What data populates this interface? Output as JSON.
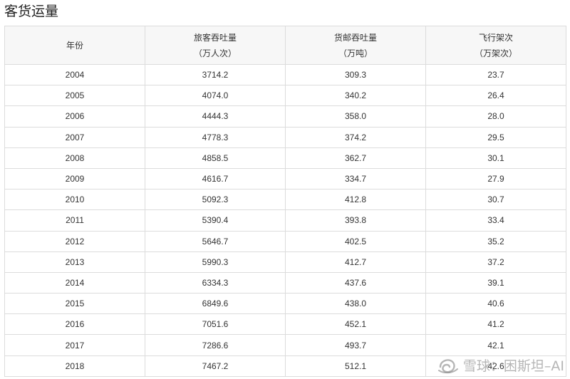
{
  "heading": "客货运量",
  "table": {
    "headers": [
      {
        "line1": "年份",
        "line2": ""
      },
      {
        "line1": "旅客吞吐量",
        "line2": "（万人次）"
      },
      {
        "line1": "货邮吞吐量",
        "line2": "（万吨）"
      },
      {
        "line1": "飞行架次",
        "line2": "（万架次）"
      }
    ],
    "rows": [
      [
        "2004",
        "3714.2",
        "309.3",
        "23.7"
      ],
      [
        "2005",
        "4074.0",
        "340.2",
        "26.4"
      ],
      [
        "2006",
        "4444.3",
        "358.0",
        "28.0"
      ],
      [
        "2007",
        "4778.3",
        "374.2",
        "29.5"
      ],
      [
        "2008",
        "4858.5",
        "362.7",
        "30.1"
      ],
      [
        "2009",
        "4616.7",
        "334.7",
        "27.9"
      ],
      [
        "2010",
        "5092.3",
        "412.8",
        "30.7"
      ],
      [
        "2011",
        "5390.4",
        "393.8",
        "33.4"
      ],
      [
        "2012",
        "5646.7",
        "402.5",
        "35.2"
      ],
      [
        "2013",
        "5990.3",
        "412.7",
        "37.2"
      ],
      [
        "2014",
        "6334.3",
        "437.6",
        "39.1"
      ],
      [
        "2015",
        "6849.6",
        "438.0",
        "40.6"
      ],
      [
        "2016",
        "7051.6",
        "452.1",
        "41.2"
      ],
      [
        "2017",
        "7286.6",
        "493.7",
        "42.1"
      ],
      [
        "2018",
        "7467.2",
        "512.1",
        "42.6"
      ]
    ]
  },
  "watermark": {
    "text": "雪球：困斯坦–AI",
    "icon": "snowball-logo-icon"
  }
}
